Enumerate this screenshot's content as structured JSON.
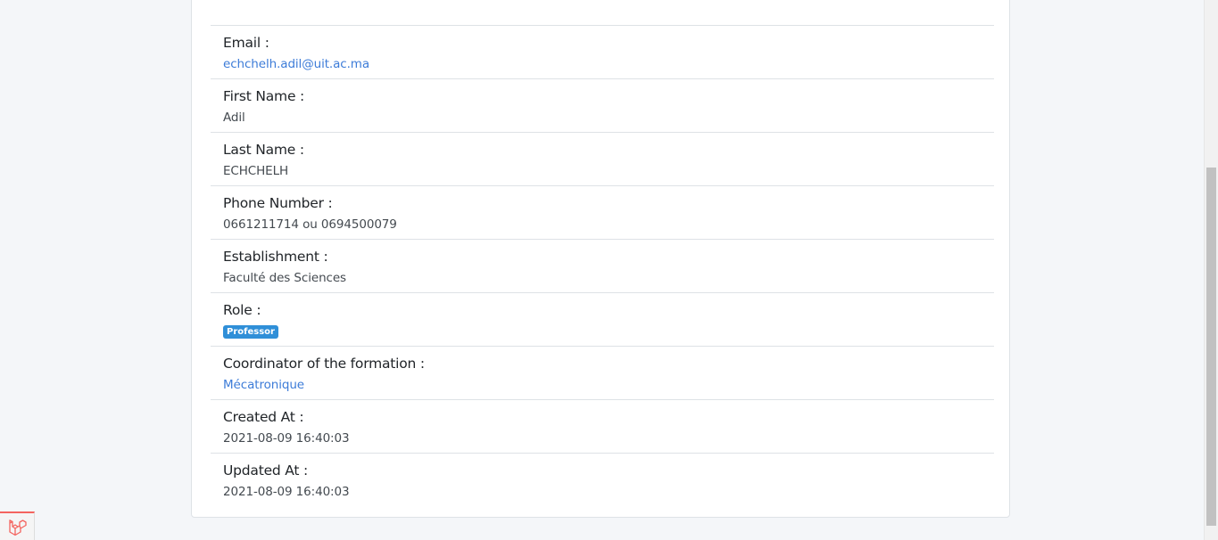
{
  "profile": {
    "items": [
      {
        "label": "Email :",
        "value": "echchelh.adil@uit.ac.ma"
      },
      {
        "label": "First Name :",
        "value": "Adil"
      },
      {
        "label": "Last Name :",
        "value": "ECHCHELH"
      },
      {
        "label": "Phone Number :",
        "value": "0661211714 ou 0694500079"
      },
      {
        "label": "Establishment :",
        "value": "Faculté des Sciences"
      },
      {
        "label": "Role :",
        "value": "Professor"
      },
      {
        "label": "Coordinator of the formation :",
        "value": "Mécatronique"
      },
      {
        "label": "Created At :",
        "value": "2021-08-09 16:40:03"
      },
      {
        "label": "Updated At :",
        "value": "2021-08-09 16:40:03"
      }
    ]
  },
  "colors": {
    "link": "#3d7cd8",
    "badge": "#2f8fd8",
    "laravel": "#f4645f"
  },
  "icons": {
    "debug_toolbar": "laravel-logo-icon"
  }
}
